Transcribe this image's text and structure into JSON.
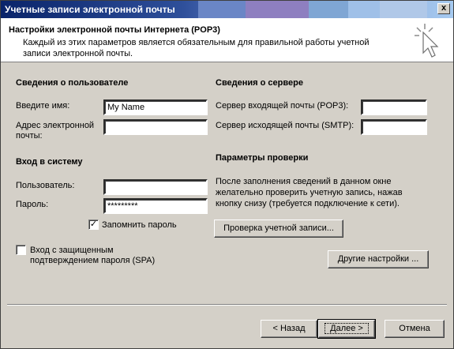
{
  "window": {
    "title": "Учетные записи электронной почты",
    "close_symbol": "x",
    "titlebar_colors": [
      "#0a246a",
      "#3a5fae",
      "#6a86c6",
      "#8e7fc0",
      "#9fc0e8",
      "#7fa6d4",
      "#b0c8e8"
    ]
  },
  "header": {
    "title": "Настройки электронной почты Интернета (POP3)",
    "subtitle": "Каждый из этих параметров является обязательным для правильной работы учетной записи электронной почты.",
    "icon": "wizard-cursor-icon"
  },
  "user_info": {
    "section_title": "Сведения о пользователе",
    "name_label": "Введите имя:",
    "name_value": "My Name",
    "email_label": "Адрес электронной почты:",
    "email_value": ""
  },
  "login": {
    "section_title": "Вход в систему",
    "user_label": "Пользователь:",
    "user_value": "",
    "password_label": "Пароль:",
    "password_value": "*********",
    "remember_label": "Запомнить пароль",
    "remember_checked": true,
    "spa_label": "Вход с защищенным подтверждением пароля (SPA)",
    "spa_checked": false
  },
  "server_info": {
    "section_title": "Сведения о сервере",
    "incoming_label": "Сервер входящей почты (POP3):",
    "incoming_value": "",
    "outgoing_label": "Сервер исходящей почты (SMTP):",
    "outgoing_value": ""
  },
  "verify": {
    "section_title": "Параметры проверки",
    "description": "После заполнения сведений в данном окне желательно проверить учетную запись, нажав кнопку снизу (требуется подключение к сети).",
    "test_button": "Проверка учетной записи...",
    "more_settings_button": "Другие настройки ..."
  },
  "footer": {
    "back_button": "< Назад",
    "next_button": "Далее >",
    "cancel_button": "Отмена"
  }
}
